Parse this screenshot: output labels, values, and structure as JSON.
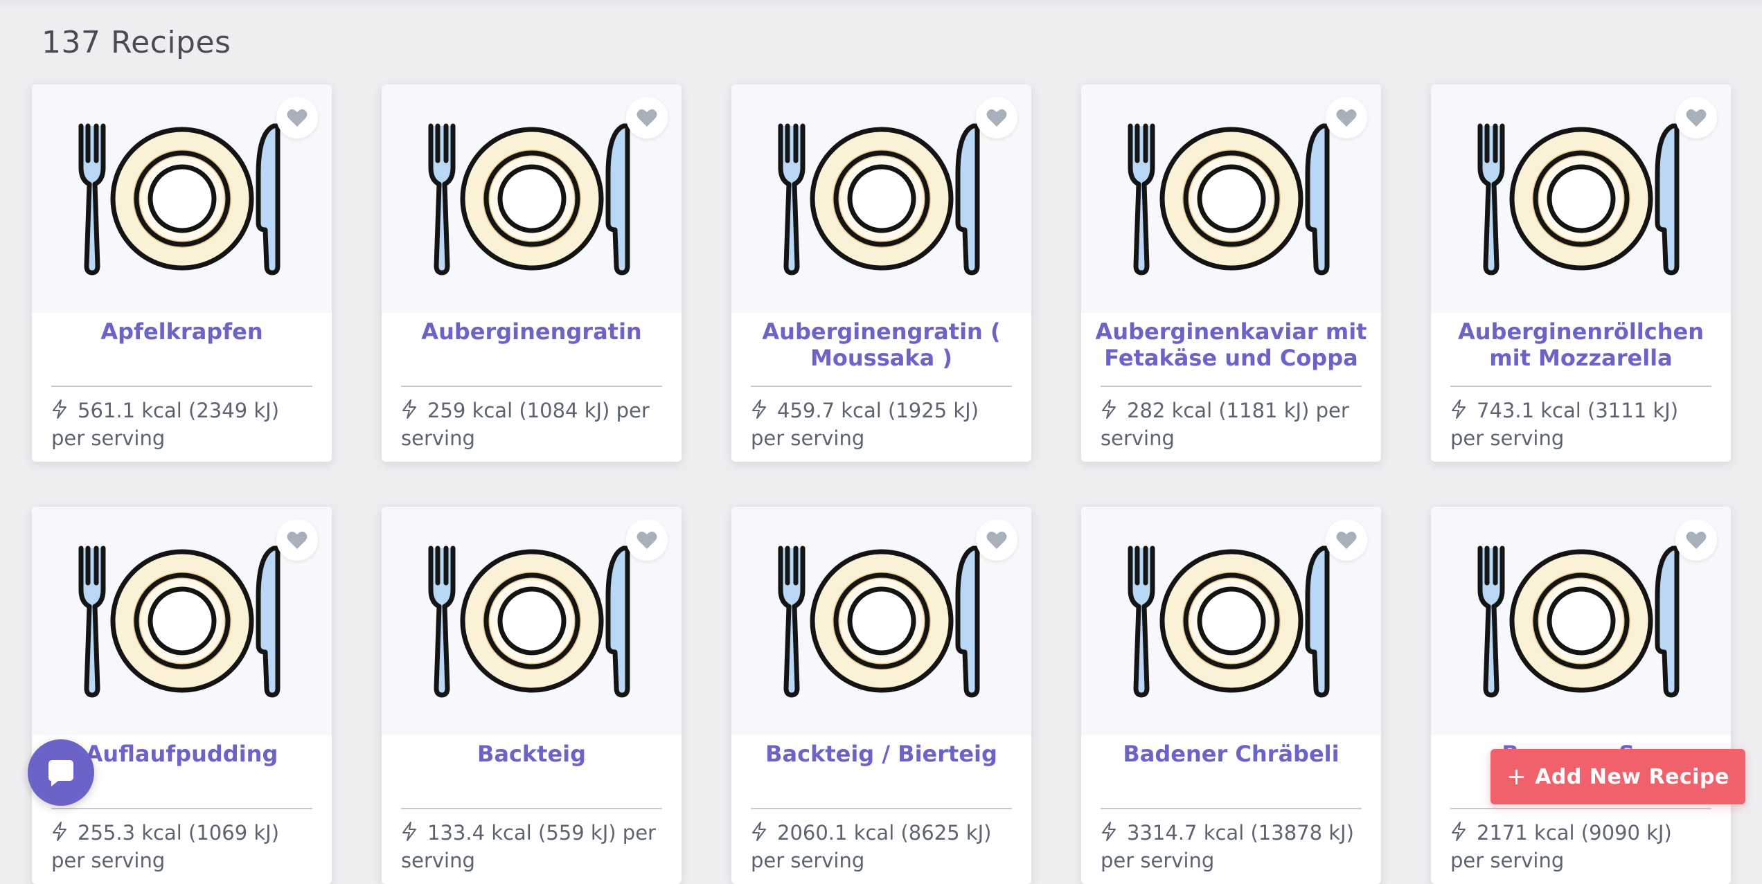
{
  "page": {
    "title": "137 Recipes"
  },
  "colors": {
    "accent": "#6c63c9",
    "add_button": "#f0616c"
  },
  "recipes": [
    {
      "title": "Apfelkrapfen",
      "calories": "561.1 kcal (2349 kJ) per serving"
    },
    {
      "title": "Auberginengratin",
      "calories": "259 kcal (1084 kJ) per serving"
    },
    {
      "title": "Auberginengratin ( Moussaka )",
      "calories": "459.7 kcal (1925 kJ) per serving"
    },
    {
      "title": "Auberginenkaviar mit Fetakäse und Coppa",
      "calories": "282 kcal (1181 kJ) per serving"
    },
    {
      "title": "Auberginenröllchen mit Mozzarella",
      "calories": "743.1 kcal (3111 kJ) per serving"
    },
    {
      "title": "Auflaufpudding",
      "calories": "255.3 kcal (1069 kJ) per serving"
    },
    {
      "title": "Backteig",
      "calories": "133.4 kcal (559 kJ) per serving"
    },
    {
      "title": "Backteig / Bierteig",
      "calories": "2060.1 kcal (8625 kJ) per serving"
    },
    {
      "title": "Badener Chräbeli",
      "calories": "3314.7 kcal (13878 kJ) per serving"
    },
    {
      "title": "Bananen S...",
      "calories": "2171 kcal (9090 kJ) per serving"
    }
  ],
  "icons": {
    "card_image": "plate-cutlery-icon",
    "favorite": "heart-icon",
    "energy": "bolt-icon",
    "chat": "chat-icon"
  },
  "actions": {
    "add_label": "Add New Recipe",
    "add_icon": "+"
  }
}
